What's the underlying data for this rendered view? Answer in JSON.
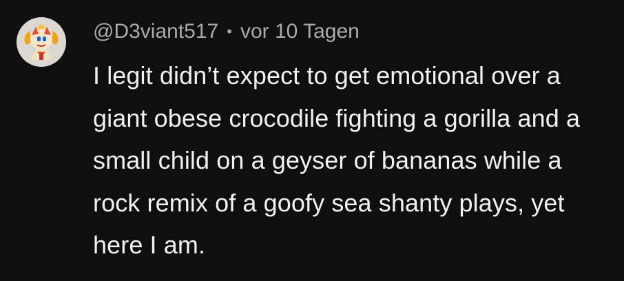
{
  "comment": {
    "author_handle": "@D3viant517",
    "separator": "•",
    "timestamp": "vor 10 Tagen",
    "text": "I legit didn’t expect to get emotional over a giant obese crocodile fighting a gorilla and a small child on a geyser of bananas while a rock remix of a goofy sea shanty plays, yet here I am.",
    "avatar_icon": "avatar-character-icon"
  },
  "colors": {
    "background": "#0f0f0f",
    "text_primary": "#f1f1f1",
    "text_secondary": "#aaaaaa"
  }
}
